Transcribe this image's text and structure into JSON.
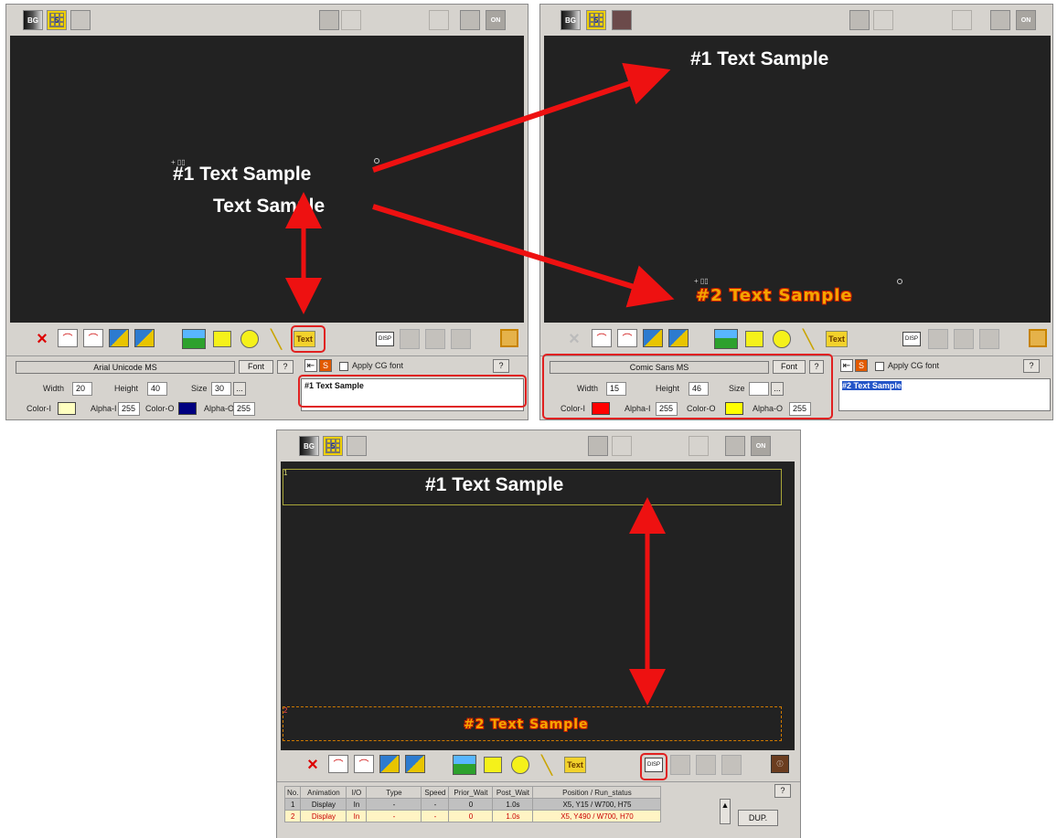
{
  "panelA": {
    "canvas_text_1": "#1 Text Sample",
    "canvas_text_2": "Text Sample",
    "font_name": "Arial Unicode MS",
    "font_button": "Font",
    "help": "?",
    "width_label": "Width",
    "width_value": "20",
    "height_label": "Height",
    "height_value": "40",
    "size_label": "Size",
    "size_value": "30",
    "ellipsis": "...",
    "apply_cg_font": "Apply CG font",
    "editor_text": "#1 Text Sample",
    "color_i_label": "Color-I",
    "alpha_i_label": "Alpha-I",
    "alpha_i_value": "255",
    "color_o_label": "Color-O",
    "alpha_o_label": "Alpha-O",
    "alpha_o_value": "255",
    "color_i": "#ffffc0",
    "color_o": "#000080",
    "toolbar_text_label": "Text"
  },
  "panelB": {
    "canvas_text_1": "#1 Text Sample",
    "canvas_text_2": "#2 Text Sample",
    "font_name": "Comic Sans MS",
    "font_button": "Font",
    "help": "?",
    "width_label": "Width",
    "width_value": "15",
    "height_label": "Height",
    "height_value": "46",
    "size_label": "Size",
    "size_value": "",
    "ellipsis": "...",
    "apply_cg_font": "Apply CG font",
    "editor_text": "#2 Text Sample",
    "color_i_label": "Color-I",
    "alpha_i_label": "Alpha-I",
    "alpha_i_value": "255",
    "color_o_label": "Color-O",
    "alpha_o_label": "Alpha-O",
    "alpha_o_value": "255",
    "color_i": "#ff0000",
    "color_o": "#ffff00",
    "toolbar_text_label": "Text"
  },
  "panelC": {
    "canvas_text_1": "#1 Text Sample",
    "canvas_text_2": "#2 Text Sample",
    "region1_tag": "1",
    "region2_tag": "2",
    "toolbar_text_label": "Text",
    "disp_label": "DISP",
    "help": "?",
    "dup_button": "DUP.",
    "list_headers": [
      "No.",
      "Animation",
      "I/O",
      "Type",
      "Speed",
      "Prior_Wait",
      "Post_Wait",
      "Position / Run_status"
    ],
    "rows": [
      [
        "1",
        "Display",
        "In",
        "-",
        "-",
        "0",
        "1.0s",
        "X5, Y15 / W700, H75"
      ],
      [
        "2",
        "Display",
        "In",
        "-",
        "-",
        "0",
        "1.0s",
        "X5, Y490 / W700, H70"
      ]
    ]
  },
  "top_buttons": {
    "bg": "BG",
    "five": "5",
    "on": "ON"
  },
  "colors": {
    "arrow": "#ee1111",
    "canvas_bg": "#222222",
    "panel_bg": "#d6d3ce",
    "highlight": "#e02020"
  }
}
